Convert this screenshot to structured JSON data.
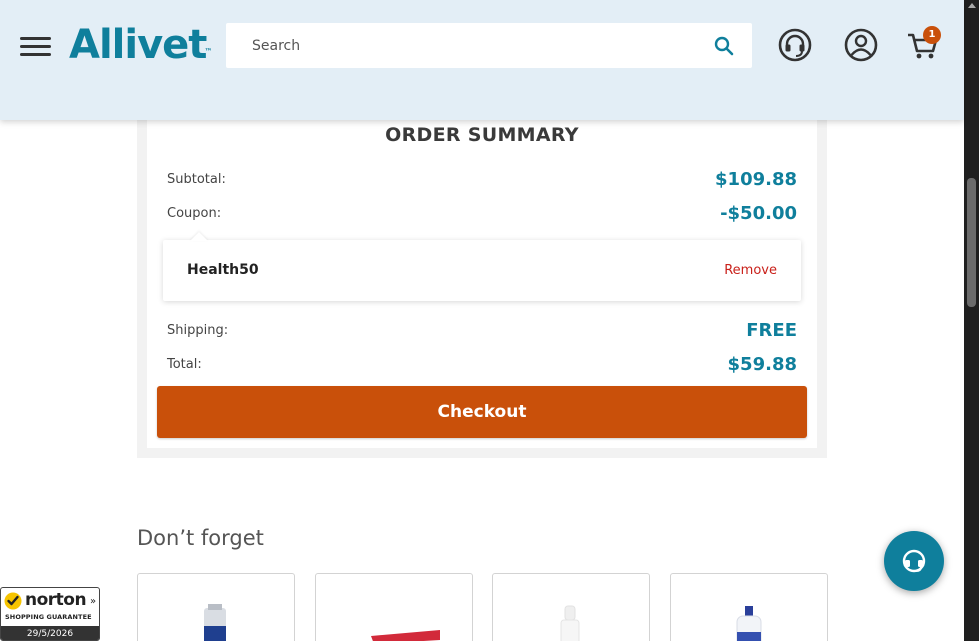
{
  "header": {
    "logo_text": "Allivet",
    "logo_tm": "™",
    "search_placeholder": "Search",
    "cart_count": "1",
    "icons": [
      "menu-icon",
      "search-icon",
      "headset-icon",
      "account-icon",
      "cart-icon"
    ]
  },
  "order_summary": {
    "title": "ORDER SUMMARY",
    "subtotal_label": "Subtotal:",
    "subtotal_value": "$109.88",
    "coupon_label": "Coupon:",
    "coupon_value": "-$50.00",
    "coupon_code": "Health50",
    "coupon_remove": "Remove",
    "shipping_label": "Shipping:",
    "shipping_value": "FREE",
    "total_label": "Total:",
    "total_value": "$59.88",
    "checkout_label": "Checkout"
  },
  "dont_forget": {
    "heading": "Don’t forget"
  },
  "norton": {
    "brand": "norton",
    "guarantee": "SHOPPING GUARANTEE",
    "date": "29/5/2026"
  },
  "colors": {
    "brand_teal": "#0f7f9c",
    "checkout_orange": "#c9500a",
    "header_bg": "#e3eef6",
    "remove_red": "#c9201a"
  }
}
